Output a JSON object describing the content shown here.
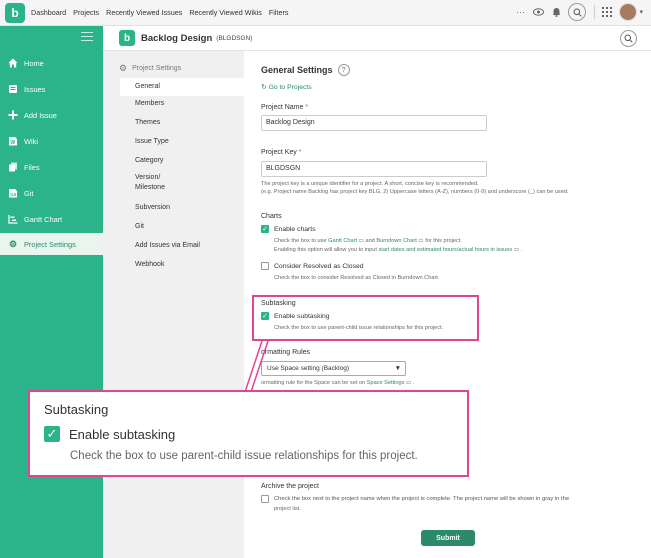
{
  "topbar": {
    "logo": "b",
    "nav": [
      "Dashboard",
      "Projects",
      "Recently Viewed Issues",
      "Recently Viewed Wikis",
      "Filters"
    ],
    "icons": [
      "more-icon",
      "eye-icon",
      "bell-icon",
      "search-icon",
      "apps-grid-icon",
      "avatar"
    ]
  },
  "sidebar": {
    "items": [
      {
        "label": "Home",
        "icon": "home-icon"
      },
      {
        "label": "Issues",
        "icon": "issues-icon"
      },
      {
        "label": "Add Issue",
        "icon": "plus-icon"
      },
      {
        "label": "Wiki",
        "icon": "wiki-icon"
      },
      {
        "label": "Files",
        "icon": "files-icon"
      },
      {
        "label": "Git",
        "icon": "git-icon"
      },
      {
        "label": "Gantt Chart",
        "icon": "gantt-icon"
      },
      {
        "label": "Project Settings",
        "icon": "gear-icon",
        "active": true
      }
    ]
  },
  "project": {
    "logo": "b",
    "name": "Backlog Design",
    "key": "(BLGDSGN)"
  },
  "settings_nav": {
    "heading": "Project Settings",
    "items": [
      "General",
      "Members",
      "Themes",
      "Issue Type",
      "Category",
      "Version/",
      "Milestone",
      "Subversion",
      "Git",
      "Add Issues via Email",
      "Webhook"
    ]
  },
  "general": {
    "title": "General Settings",
    "help": "?",
    "go_to_projects": "Go to Projects",
    "project_name_label": "Project Name",
    "project_name_value": "Backlog Design",
    "project_key_label": "Project Key",
    "project_key_value": "BLGDSGN",
    "key_help_1": "The project key is a unique identifier for a project. A short, concise key is recommended.",
    "key_help_2": "(e.g. Project name Backlog has project key BLG, 2) Uppercase letters (A-Z), numbers (0-9) and underscore (_) can be used.",
    "charts_label": "Charts",
    "enable_charts": "Enable charts",
    "charts_help_1a": "Check the box to use",
    "charts_help_gantt": "Gantt Chart",
    "charts_help_and": "and",
    "charts_help_burndown": "Burndown Chart",
    "charts_help_1b": "for this project.",
    "charts_help_2a": "Enabling this option will allow you to input",
    "charts_help_2b": "start dates and estimated hours/actual hours in issues",
    "consider_resolved": "Consider Resolved as Closed",
    "resolved_help": "Check the box to consider Resolved as Closed in Burndown Chart.",
    "subtasking_label": "Subtasking",
    "enable_subtasking": "Enable subtasking",
    "subtasking_help": "Check the box to use parent-child issue relationships for this project.",
    "formatting_label": "ormatting Rules",
    "formatting_select": "Use Space setting (Backlog)",
    "formatting_help_a": "ormatting rule for the Space can be set on",
    "formatting_help_link": "Space Settings",
    "archive_label": "Archive the project",
    "archive_help_1": "Check the box next to the project name when the project is complete. The project name will be shown in gray in the",
    "archive_help_2": "project list.",
    "submit": "Submit"
  },
  "callout": {
    "title": "Subtasking",
    "checkbox_label": "Enable subtasking",
    "help": "Check the box to use parent-child issue relationships for this project."
  },
  "colors": {
    "brand": "#2bb38a",
    "brand_dark": "#2a8a69",
    "highlight": "#e0468f",
    "required": "#e04d4d"
  }
}
